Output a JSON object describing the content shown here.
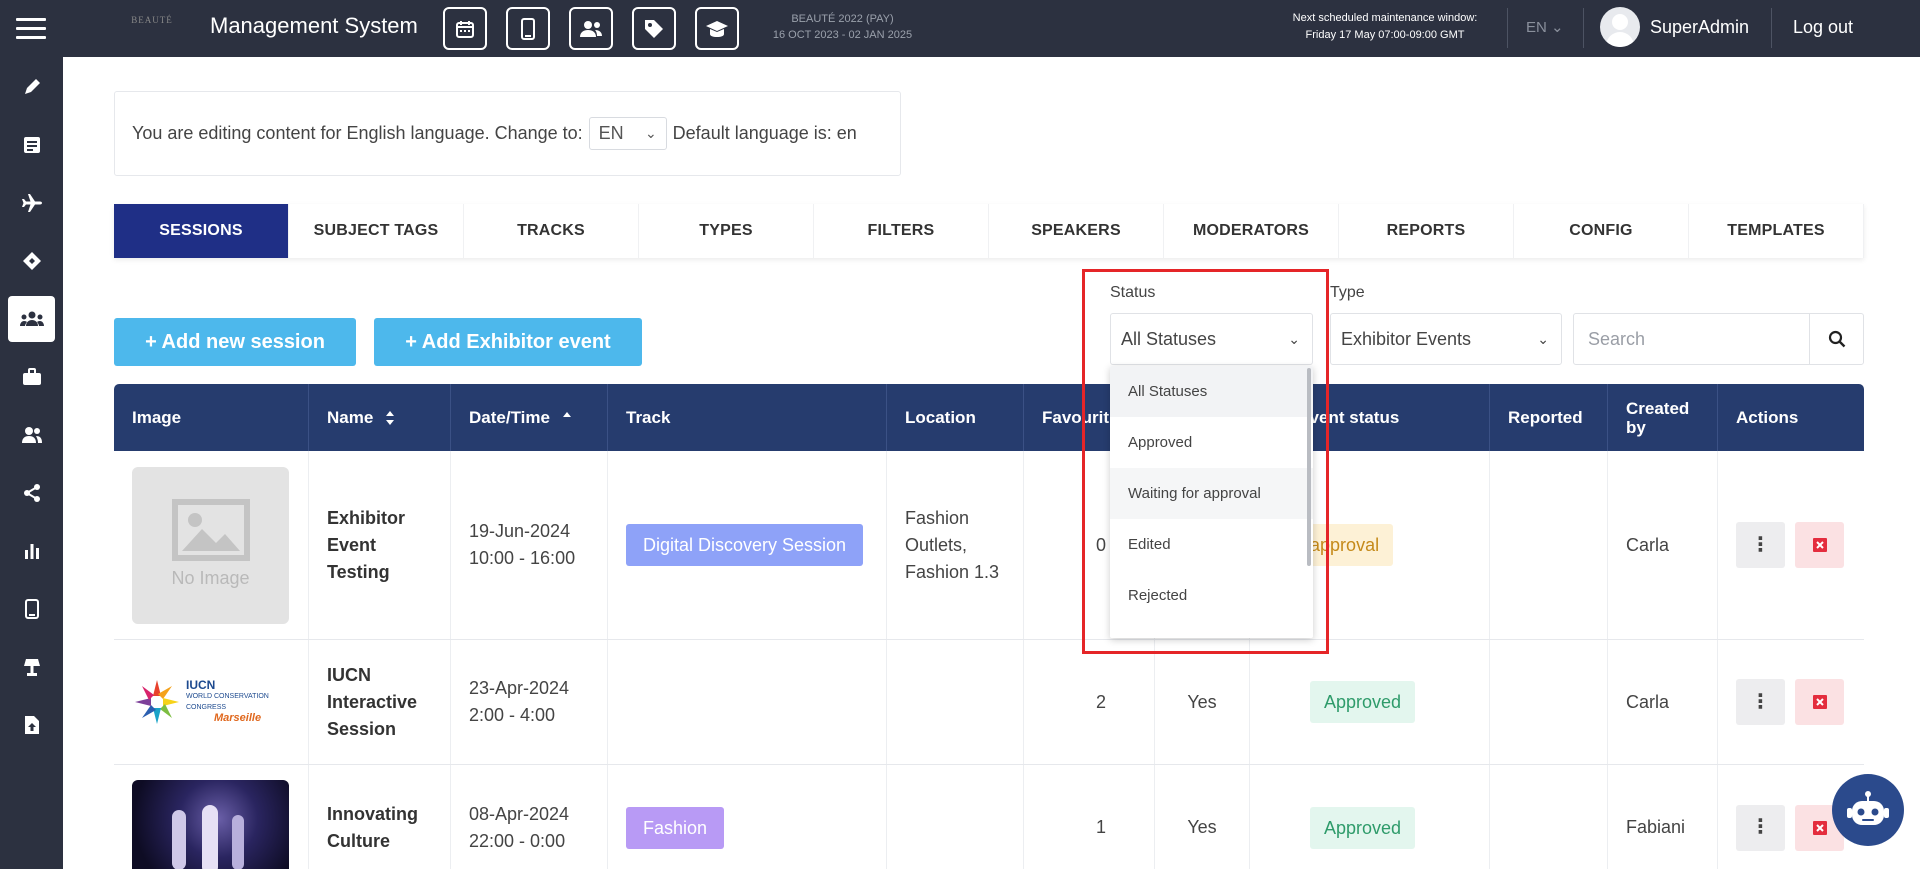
{
  "header": {
    "brand_logo": "BEAUTÉ",
    "title": "Management System",
    "event_name": "BEAUTÉ 2022 (PAY)",
    "event_dates": "16 OCT 2023 - 02 JAN 2025",
    "maintenance_line1": "Next scheduled maintenance window:",
    "maintenance_line2": "Friday 17 May 07:00-09:00 GMT",
    "language": "EN",
    "username": "SuperAdmin",
    "logout": "Log out",
    "icon_buttons": [
      "calendar-icon",
      "mobile-icon",
      "users-icon",
      "tag-icon",
      "graduation-cap-icon"
    ]
  },
  "sidebar": {
    "items": [
      "pencil-icon",
      "list-icon",
      "plane-icon",
      "ticket-icon",
      "users-group-icon",
      "briefcase-icon",
      "user-pair-icon",
      "share-icon",
      "bar-chart-icon",
      "mobile-icon",
      "lamp-icon",
      "upload-icon"
    ],
    "active_index": 4
  },
  "language_notice": {
    "prefix": "You are editing content for English language. Change to:",
    "selected": "EN",
    "suffix": "Default language is: en"
  },
  "tabs": [
    {
      "label": "SESSIONS",
      "active": true
    },
    {
      "label": "SUBJECT TAGS"
    },
    {
      "label": "TRACKS"
    },
    {
      "label": "TYPES"
    },
    {
      "label": "FILTERS"
    },
    {
      "label": "SPEAKERS"
    },
    {
      "label": "MODERATORS"
    },
    {
      "label": "REPORTS"
    },
    {
      "label": "CONFIG"
    },
    {
      "label": "TEMPLATES"
    }
  ],
  "actions": {
    "add_session": "+  Add new session",
    "add_exhibitor": "+  Add Exhibitor event"
  },
  "filters": {
    "status_label": "Status",
    "status_value": "All Statuses",
    "type_label": "Type",
    "type_value": "Exhibitor Events",
    "search_placeholder": "Search",
    "status_options": [
      "All Statuses",
      "Approved",
      "Waiting for approval",
      "Edited",
      "Rejected"
    ]
  },
  "table": {
    "headers": [
      "Image",
      "Name",
      "Date/Time",
      "Track",
      "Location",
      "Favourite",
      "",
      "Exhibitor event status",
      "Reported",
      "Created by",
      "Actions"
    ],
    "header_favourite_visible": "Favourit",
    "header_status_visible": "itor event status",
    "header_created_line1": "Created",
    "header_created_line2": "by",
    "no_image": "No Image",
    "rows": [
      {
        "name_lines": [
          "Exhibitor",
          "Event",
          "Testing"
        ],
        "date": "19-Jun-2024",
        "time": "10:00 - 16:00",
        "track": "Digital Discovery Session",
        "track_color": "#8ea2f8",
        "location_lines": [
          "Fashion",
          "Outlets,",
          "Fashion 1.3"
        ],
        "favourites": "0",
        "visible": "",
        "status": "Waiting for approval",
        "status_visible": "ting for approval",
        "reported": "",
        "created_by": "Carla"
      },
      {
        "name_lines": [
          "IUCN",
          "Interactive",
          "Session"
        ],
        "date": "23-Apr-2024",
        "time": "2:00 - 4:00",
        "track": "",
        "location_lines": [],
        "favourites": "2",
        "visible": "Yes",
        "status": "Approved",
        "reported": "",
        "created_by": "Carla",
        "logo_line1": "IUCN",
        "logo_line2": "WORLD CONSERVATION",
        "logo_line3": "CONGRESS",
        "logo_line4": "Marseille"
      },
      {
        "name_lines": [
          "Innovating",
          "Culture"
        ],
        "date": "08-Apr-2024",
        "time": "22:00 - 0:00",
        "track": "Fashion",
        "track_color": "#b89af5",
        "location_lines": [],
        "favourites": "1",
        "visible": "Yes",
        "status": "Approved",
        "reported": "",
        "created_by": "Fabiani"
      }
    ]
  },
  "colors": {
    "topbar": "#2c3140",
    "active_tab": "#1f2f86",
    "table_header": "#263c6e",
    "primary_button": "#4db8ec",
    "highlight": "#e52528"
  }
}
